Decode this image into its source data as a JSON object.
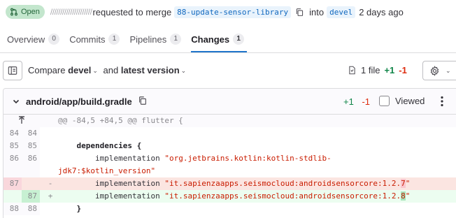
{
  "header": {
    "status": "Open",
    "author": "/////////////////////",
    "requested_text": "requested to merge",
    "source_branch": "88-update-sensor-library",
    "into_text": "into",
    "target_branch": "devel",
    "time_ago": "2 days ago"
  },
  "tabs": [
    {
      "label": "Overview",
      "count": "0"
    },
    {
      "label": "Commits",
      "count": "1"
    },
    {
      "label": "Pipelines",
      "count": "1"
    },
    {
      "label": "Changes",
      "count": "1",
      "active": true
    }
  ],
  "compare": {
    "compare_label": "Compare",
    "base": "devel",
    "and_label": "and",
    "head": "latest version",
    "files_count": "1 file",
    "additions": "+1",
    "deletions": "-1"
  },
  "file": {
    "path": "android/app/build.gradle",
    "additions": "+1",
    "deletions": "-1",
    "viewed_label": "Viewed"
  },
  "diff": {
    "hunk": "@@ -84,5 +84,5 @@ flutter {",
    "lines": [
      {
        "old": "84",
        "new": "84",
        "sym": "",
        "code": ""
      },
      {
        "old": "85",
        "new": "85",
        "sym": "",
        "code": "    dependencies {"
      },
      {
        "old": "86",
        "new": "86",
        "sym": "",
        "code_a": "        implementation ",
        "code_str": "\"org.jetbrains.kotlin:kotlin-stdlib-\njdk7:$kotlin_version\""
      },
      {
        "old": "87",
        "new": "",
        "sym": "-",
        "code_a": "        implementation ",
        "code_str1": "\"it.sapienzaapps.seismocloud:androidsensorcore:1.2.",
        "code_hl": "7",
        "code_str2": "\""
      },
      {
        "old": "",
        "new": "87",
        "sym": "+",
        "code_a": "        implementation ",
        "code_str1": "\"it.sapienzaapps.seismocloud:androidsensorcore:1.2.",
        "code_hl": "8",
        "code_str2": "\""
      },
      {
        "old": "88",
        "new": "88",
        "sym": "",
        "code": "    }"
      }
    ]
  },
  "icons": {
    "status": "merge-request-icon",
    "copy": "copy-icon",
    "tree": "file-tree-icon",
    "file": "file-icon",
    "settings": "gear-icon",
    "expand": "arrow-up-icon",
    "kebab": "kebab-icon"
  },
  "colors": {
    "accent": "#1f75cb",
    "added": "#108548",
    "removed": "#dd2b0e",
    "open_badge_bg": "#c3e6cd"
  }
}
